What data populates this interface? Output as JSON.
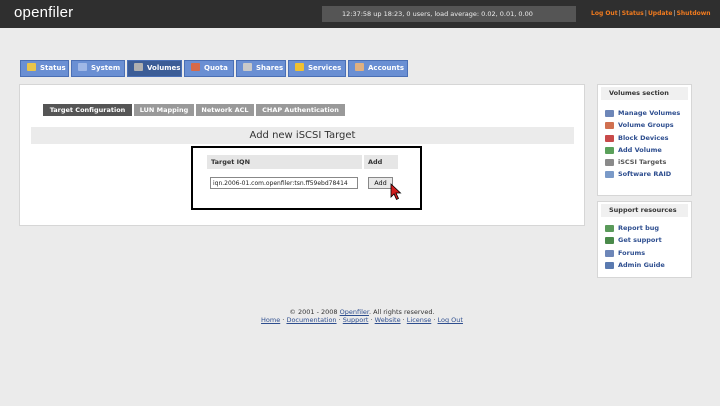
{
  "header": {
    "logo": "openfiler",
    "uptime": "12:37:58 up 18:23, 0 users, load average: 0.02, 0.01, 0.00",
    "links": [
      "Log Out",
      "Status",
      "Update",
      "Shutdown"
    ]
  },
  "tabs": [
    {
      "label": "Status",
      "icon": "status-icon",
      "color": "#e8c44a"
    },
    {
      "label": "System",
      "icon": "system-icon",
      "color": "#9fb7e6"
    },
    {
      "label": "Volumes",
      "icon": "volumes-icon",
      "color": "#b0b0b0",
      "active": true
    },
    {
      "label": "Quota",
      "icon": "quota-icon",
      "color": "#d66a4a"
    },
    {
      "label": "Shares",
      "icon": "shares-icon",
      "color": "#c9c9c9"
    },
    {
      "label": "Services",
      "icon": "services-icon",
      "color": "#f0c030"
    },
    {
      "label": "Accounts",
      "icon": "accounts-icon",
      "color": "#e0b080"
    }
  ],
  "subtabs": [
    "Target Configuration",
    "LUN Mapping",
    "Network ACL",
    "CHAP Authentication"
  ],
  "main": {
    "section_title": "Add new iSCSI Target",
    "col_target_iqn": "Target IQN",
    "col_add": "Add",
    "iqn_value": "iqn.2006-01.com.openfiler:tsn.ff59ebd78414",
    "add_button": "Add"
  },
  "sidebar": {
    "volumes_title": "Volumes section",
    "volumes_items": [
      "Manage Volumes",
      "Volume Groups",
      "Block Devices",
      "Add Volume",
      "iSCSI Targets",
      "Software RAID"
    ],
    "support_title": "Support resources",
    "support_items": [
      "Report bug",
      "Get support",
      "Forums",
      "Admin Guide"
    ]
  },
  "footer": {
    "copyright": "© 2001 - 2008",
    "brand": "Openfiler",
    "rights": ". All rights reserved.",
    "links": [
      "Home",
      "Documentation",
      "Support",
      "Website",
      "License",
      "Log Out"
    ]
  },
  "colors": {
    "accent_orange": "#f27b1e",
    "tab_blue": "#6a8fd3",
    "tab_active": "#3c5d97",
    "link_blue": "#2e4e8f"
  }
}
